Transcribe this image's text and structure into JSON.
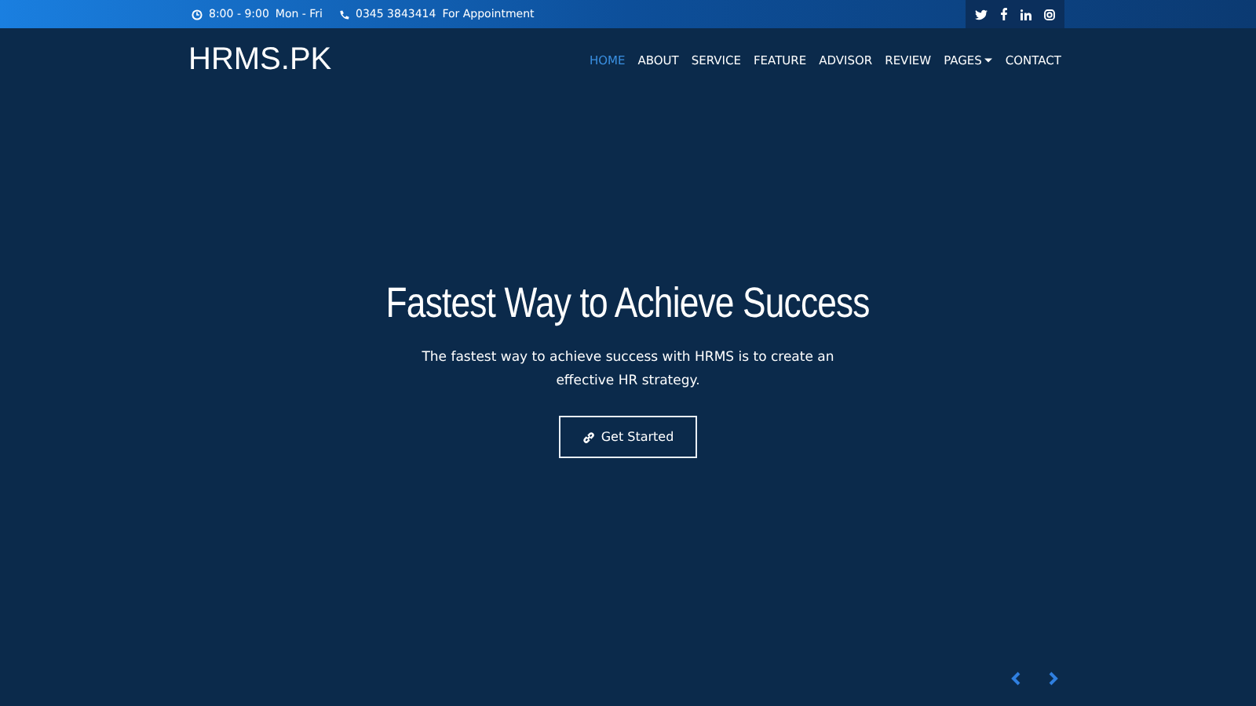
{
  "topbar": {
    "hours": "8:00 - 9:00",
    "days": "Mon - Fri",
    "phone": "0345 3843414",
    "phone_note": "For Appointment"
  },
  "brand": "HRMS.PK",
  "nav": [
    {
      "label": "HOME",
      "selected": true
    },
    {
      "label": "ABOUT",
      "selected": false
    },
    {
      "label": "SERVICE",
      "selected": false
    },
    {
      "label": "FEATURE",
      "selected": false
    },
    {
      "label": "ADVISOR",
      "selected": false
    },
    {
      "label": "REVIEW",
      "selected": false
    },
    {
      "label": "PAGES",
      "selected": false,
      "kind": "dropdown"
    },
    {
      "label": "CONTACT",
      "selected": false
    }
  ],
  "hero": {
    "title": "Fastest Way to Achieve Success",
    "text": "The fastest way to achieve success with HRMS is to create an effective HR strategy.",
    "button": "Get Started"
  }
}
